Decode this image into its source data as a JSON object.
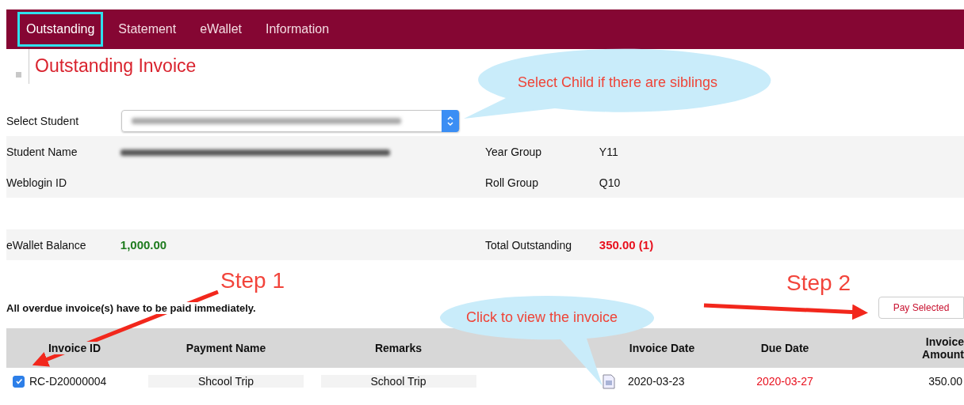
{
  "tabs": [
    {
      "label": "Outstanding",
      "selected": true,
      "highlighted": true
    },
    {
      "label": "Statement",
      "selected": false,
      "highlighted": false
    },
    {
      "label": "eWallet",
      "selected": false,
      "highlighted": false
    },
    {
      "label": "Information",
      "selected": false,
      "highlighted": false
    }
  ],
  "page_title": "Outstanding Invoice",
  "student_select": {
    "label": "Select Student",
    "redacted": true
  },
  "info_rows": [
    {
      "left": {
        "label": "Student Name",
        "redacted": true
      },
      "right": {
        "label": "Year Group",
        "value": "Y11"
      }
    },
    {
      "left": {
        "label": "Weblogin ID"
      },
      "right": {
        "label": "Roll Group",
        "value": "Q10"
      }
    }
  ],
  "balance_row": {
    "left": {
      "label": "eWallet Balance",
      "value": "1,000.00",
      "kind": "positive"
    },
    "right": {
      "label": "Total Outstanding",
      "value": "350.00 (1)",
      "kind": "negative"
    }
  },
  "notice": "All overdue invoice(s) have to be paid immediately.",
  "pay_button": "Pay Selected",
  "table": {
    "columns": [
      "Invoice ID",
      "Payment Name",
      "Remarks",
      "",
      "Invoice Date",
      "Due Date",
      "Invoice Amount"
    ],
    "rows": [
      {
        "checked": true,
        "invoice_id": "RC-D20000004",
        "payment_name": "Shcool Trip",
        "remarks": "School Trip",
        "invoice_date": "2020-03-23",
        "due_date": "2020-03-27",
        "overdue": true,
        "amount": "350.00"
      }
    ]
  },
  "callouts": [
    "Select Child if there are siblings",
    "Click to view the invoice"
  ],
  "steps": [
    "Step 1",
    "Step 2"
  ]
}
